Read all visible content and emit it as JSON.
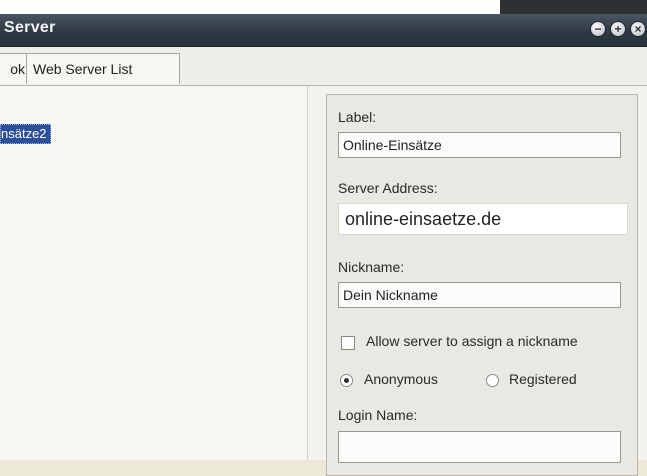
{
  "window": {
    "title": "Server",
    "buttons": [
      "minimize",
      "maximize",
      "close"
    ]
  },
  "tabs": [
    {
      "label": "ok",
      "active": false
    },
    {
      "label": "Web Server List",
      "active": true
    }
  ],
  "server_list": {
    "selected_item": "nsätze2"
  },
  "form": {
    "label_label": "Label:",
    "label_value": "Online-Einsätze",
    "address_label": "Server Address:",
    "address_value": "online-einsaetze.de",
    "nickname_label": "Nickname:",
    "nickname_value": "Dein Nickname",
    "allow_assign_label": "Allow server to assign a nickname",
    "allow_assign_checked": false,
    "auth_mode": "Anonymous",
    "anonymous_label": "Anonymous",
    "registered_label": "Registered",
    "login_label": "Login Name:",
    "login_value": ""
  }
}
